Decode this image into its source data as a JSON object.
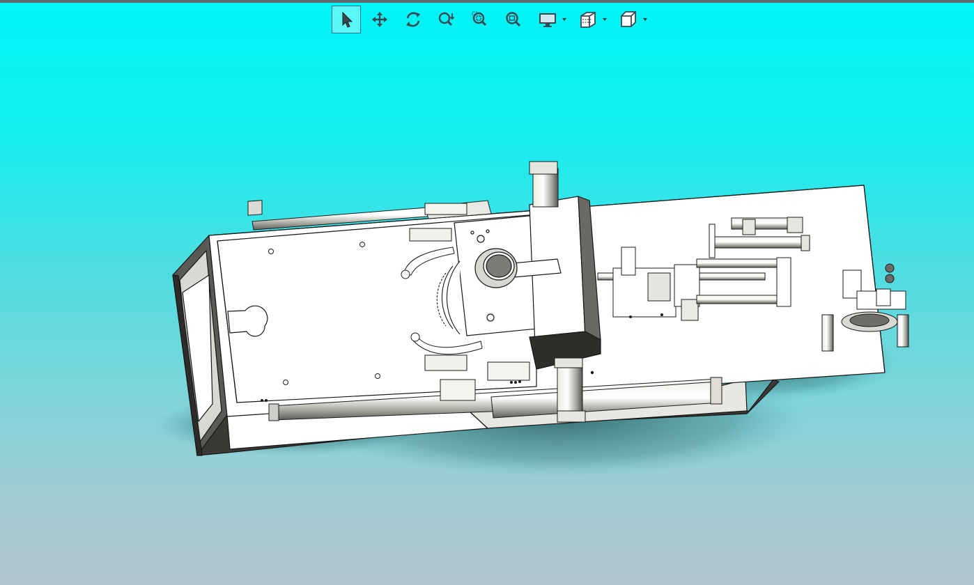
{
  "app": {
    "viewport_gradient": [
      "#00f4f6",
      "#53dce0",
      "#b1c4cc"
    ],
    "accent": "#2c6f8a"
  },
  "toolbar": {
    "tools": [
      {
        "name": "select",
        "icon": "arrow-pointer-icon",
        "active": true
      },
      {
        "name": "pan",
        "icon": "move-arrows-icon",
        "active": false
      },
      {
        "name": "rotate",
        "icon": "rotate-icon",
        "active": false
      },
      {
        "name": "zoom-in-out",
        "icon": "zoom-in-out-icon",
        "active": false
      },
      {
        "name": "zoom-to-area",
        "icon": "zoom-area-icon",
        "active": false
      },
      {
        "name": "zoom-to-fit",
        "icon": "zoom-fit-icon",
        "active": false
      },
      {
        "name": "display-style",
        "icon": "monitor-icon",
        "dropdown": true
      },
      {
        "name": "section-view",
        "icon": "section-view-icon",
        "dropdown": true
      },
      {
        "name": "view-orientation",
        "icon": "cube-icon",
        "dropdown": true
      }
    ]
  },
  "model": {
    "kind": "3D CAD assembly (machine base with cylinders and rails)",
    "body_color": "#ffffff",
    "edge_color": "#1a1a1a",
    "shadow_color": "#2f5a5e"
  }
}
